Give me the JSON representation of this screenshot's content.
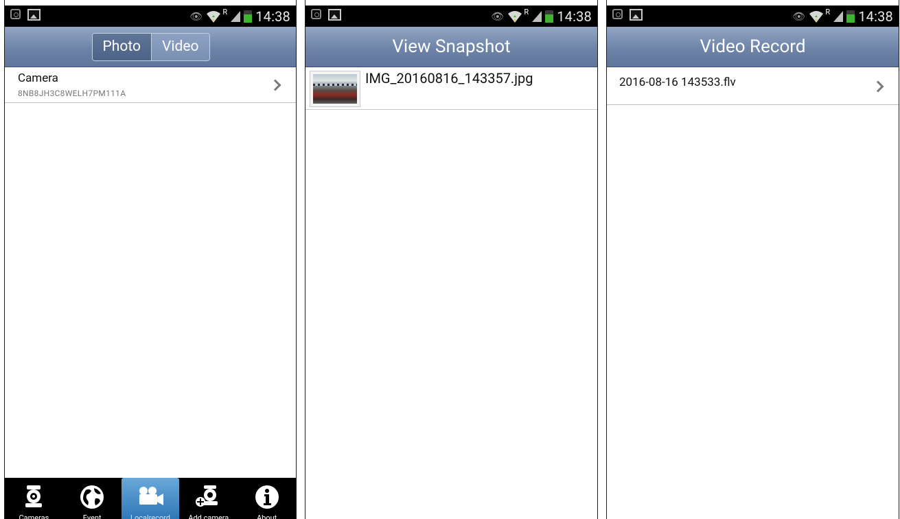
{
  "status_bar": {
    "time": "14:38",
    "roaming": "R"
  },
  "screen_photo": {
    "segment": {
      "photo_label": "Photo",
      "video_label": "Video"
    },
    "list": [
      {
        "name": "Camera",
        "id": "8NB8JH3C8WELH7PM111A"
      }
    ],
    "tabs": [
      {
        "label": "Cameras",
        "icon": "camera-icon"
      },
      {
        "label": "Event",
        "icon": "globe-icon"
      },
      {
        "label": "Localrecord",
        "icon": "video-camera-icon"
      },
      {
        "label": "Add camera",
        "icon": "add-camera-icon"
      },
      {
        "label": "About",
        "icon": "info-icon"
      }
    ]
  },
  "screen_snapshot": {
    "title": "View Snapshot",
    "files": [
      {
        "name": "IMG_20160816_143357.jpg"
      }
    ]
  },
  "screen_video": {
    "title": "Video Record",
    "files": [
      {
        "name": "2016-08-16 143533.flv"
      }
    ]
  },
  "colors": {
    "titlebar": "#6d84a8",
    "active_tab": "#3a86c6",
    "battery": "#3fb52f"
  }
}
